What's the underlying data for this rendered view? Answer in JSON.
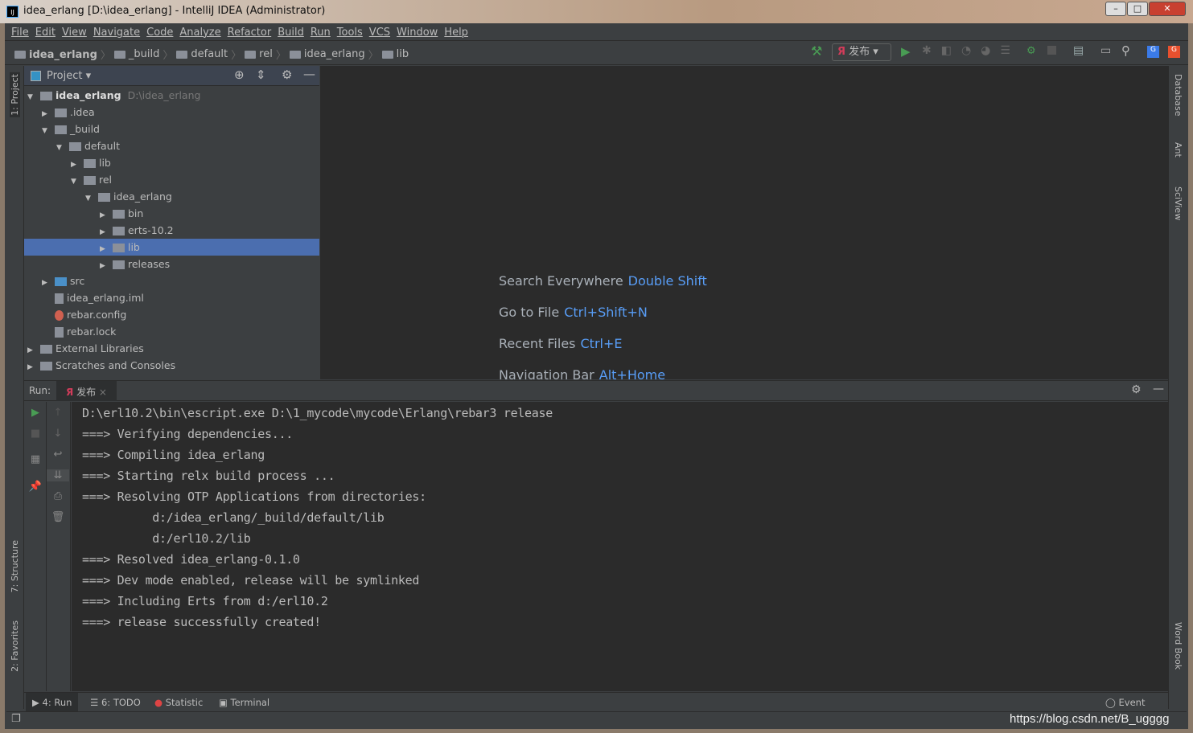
{
  "window": {
    "title": "idea_erlang [D:\\idea_erlang] - IntelliJ IDEA (Administrator)",
    "logo": "IJ"
  },
  "menu": [
    "File",
    "Edit",
    "View",
    "Navigate",
    "Code",
    "Analyze",
    "Refactor",
    "Build",
    "Run",
    "Tools",
    "VCS",
    "Window",
    "Help"
  ],
  "breadcrumb": [
    "idea_erlang",
    "_build",
    "default",
    "rel",
    "idea_erlang",
    "lib"
  ],
  "toolbar": {
    "run_config": "发布",
    "icons": [
      "build-hammer-icon",
      "run-icon",
      "debug-icon",
      "coverage-icon",
      "profile-icon",
      "profile2-icon",
      "concurrency-icon",
      "attach-debugger-icon",
      "stop-icon",
      "project-structure-icon",
      "terminal-icon",
      "search-icon",
      "google-translate-icon",
      "google-translate2-icon"
    ]
  },
  "left_strip": {
    "project": "1: Project",
    "structure": "7: Structure",
    "favorites": "2: Favorites"
  },
  "right_strip": {
    "database": "Database",
    "ant": "Ant",
    "sciview": "SciView",
    "wordbook": "Word Book"
  },
  "project": {
    "title": "Project",
    "tree": [
      {
        "label": "idea_erlang",
        "extra": "D:\\idea_erlang",
        "level": 0,
        "expanded": true,
        "type": "module"
      },
      {
        "label": ".idea",
        "level": 1,
        "expanded": false,
        "type": "folder"
      },
      {
        "label": "_build",
        "level": 1,
        "expanded": true,
        "type": "folder"
      },
      {
        "label": "default",
        "level": 2,
        "expanded": true,
        "type": "folder"
      },
      {
        "label": "lib",
        "level": 3,
        "expanded": false,
        "type": "folder"
      },
      {
        "label": "rel",
        "level": 3,
        "expanded": true,
        "type": "folder"
      },
      {
        "label": "idea_erlang",
        "level": 4,
        "expanded": true,
        "type": "folder"
      },
      {
        "label": "bin",
        "level": 5,
        "expanded": false,
        "type": "folder"
      },
      {
        "label": "erts-10.2",
        "level": 5,
        "expanded": false,
        "type": "folder"
      },
      {
        "label": "lib",
        "level": 5,
        "expanded": false,
        "type": "folder",
        "selected": true
      },
      {
        "label": "releases",
        "level": 5,
        "expanded": false,
        "type": "folder"
      },
      {
        "label": "src",
        "level": 1,
        "expanded": false,
        "type": "src"
      },
      {
        "label": "idea_erlang.iml",
        "level": 1,
        "type": "file"
      },
      {
        "label": "rebar.config",
        "level": 1,
        "type": "erlang"
      },
      {
        "label": "rebar.lock",
        "level": 1,
        "type": "file"
      },
      {
        "label": "External Libraries",
        "level": 0,
        "expanded": false,
        "type": "lib"
      },
      {
        "label": "Scratches and Consoles",
        "level": 0,
        "expanded": false,
        "type": "scratch"
      }
    ]
  },
  "editor_hints": [
    {
      "label": "Search Everywhere",
      "key": "Double Shift"
    },
    {
      "label": "Go to File",
      "key": "Ctrl+Shift+N"
    },
    {
      "label": "Recent Files",
      "key": "Ctrl+E"
    },
    {
      "label": "Navigation Bar",
      "key": "Alt+Home"
    }
  ],
  "run": {
    "label": "Run:",
    "tab": "发布",
    "console": [
      "D:\\erl10.2\\bin\\escript.exe D:\\1_mycode\\mycode\\Erlang\\rebar3 release",
      "===> Verifying dependencies...",
      "===> Compiling idea_erlang",
      "===> Starting relx build process ...",
      "===> Resolving OTP Applications from directories:",
      "          d:/idea_erlang/_build/default/lib",
      "          d:/erl10.2/lib",
      "===> Resolved idea_erlang-0.1.0",
      "===> Dev mode enabled, release will be symlinked",
      "===> Including Erts from d:/erl10.2",
      "===> release successfully created!"
    ]
  },
  "bottom_tabs": [
    "4: Run",
    "6: TODO",
    "Statistic",
    "Terminal"
  ],
  "event_log": "Event Log",
  "watermark": "https://blog.csdn.net/B_ugggg"
}
